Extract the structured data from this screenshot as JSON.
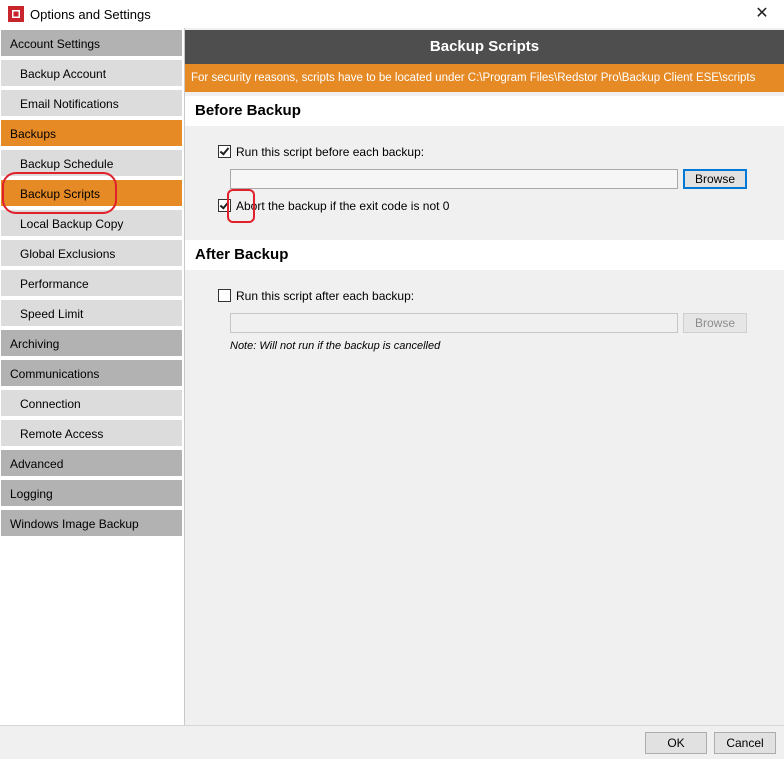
{
  "window": {
    "title": "Options and Settings",
    "close_glyph": "✕",
    "accent_color": "#e68a26",
    "header_color": "#4e4e4e"
  },
  "sidebar": {
    "items": [
      {
        "label": "Account Settings",
        "kind": "category"
      },
      {
        "label": "Backup Account",
        "kind": "sub"
      },
      {
        "label": "Email Notifications",
        "kind": "sub"
      },
      {
        "label": "Backups",
        "kind": "category",
        "highlighted": true
      },
      {
        "label": "Backup Schedule",
        "kind": "sub"
      },
      {
        "label": "Backup Scripts",
        "kind": "sub",
        "selected": true
      },
      {
        "label": "Local Backup Copy",
        "kind": "sub"
      },
      {
        "label": "Global Exclusions",
        "kind": "sub"
      },
      {
        "label": "Performance",
        "kind": "sub"
      },
      {
        "label": "Speed Limit",
        "kind": "sub"
      },
      {
        "label": "Archiving",
        "kind": "category"
      },
      {
        "label": "Communications",
        "kind": "category"
      },
      {
        "label": "Connection",
        "kind": "sub"
      },
      {
        "label": "Remote Access",
        "kind": "sub"
      },
      {
        "label": "Advanced",
        "kind": "category"
      },
      {
        "label": "Logging",
        "kind": "category"
      },
      {
        "label": "Windows Image Backup",
        "kind": "category"
      }
    ]
  },
  "main": {
    "title": "Backup Scripts",
    "notice": "For security reasons, scripts have to be located under C:\\Program Files\\Redstor Pro\\Backup Client ESE\\scripts",
    "before": {
      "heading": "Before Backup",
      "run_label": "Run this script before each backup:",
      "run_checked": true,
      "path_value": "",
      "browse_label": "Browse",
      "abort_label": "Abort the backup if the exit code is not 0",
      "abort_checked": true
    },
    "after": {
      "heading": "After Backup",
      "run_label": "Run this script after each backup:",
      "run_checked": false,
      "path_value": "",
      "browse_label": "Browse",
      "note": "Note: Will not run if the backup is cancelled"
    }
  },
  "footer": {
    "ok_label": "OK",
    "cancel_label": "Cancel"
  }
}
